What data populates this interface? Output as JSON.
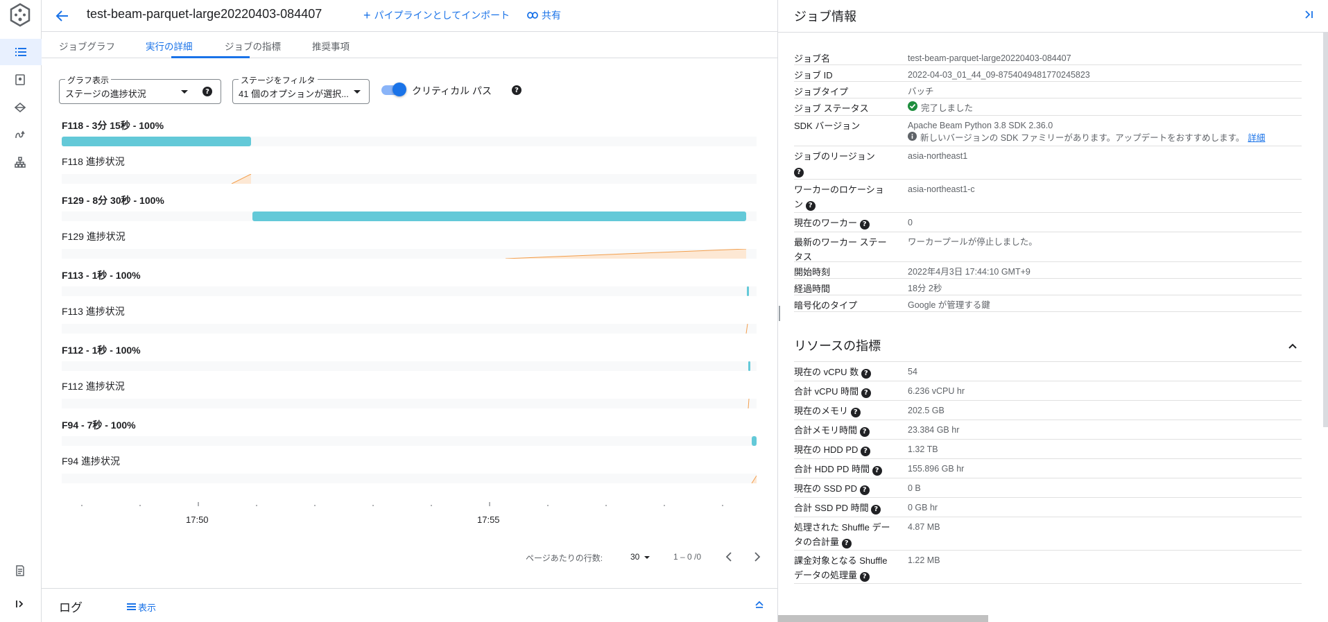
{
  "header": {
    "job_title": "test-beam-parquet-large20220403-084407",
    "import_label": "パイプラインとしてインポート",
    "share_label": "共有"
  },
  "tabs": [
    {
      "label": "ジョブグラフ"
    },
    {
      "label": "実行の詳細"
    },
    {
      "label": "ジョブの指標"
    },
    {
      "label": "推奨事項"
    }
  ],
  "controls": {
    "graph_view": {
      "label": "グラフ表示",
      "value": "ステージの進捗状況"
    },
    "stage_filter": {
      "label": "ステージをフィルタ",
      "value": "41 個のオプションが選択..."
    },
    "critical_path": {
      "label": "クリティカル パス",
      "on": true
    }
  },
  "stages": [
    {
      "title": "F118 - 3分 15秒 - 100%",
      "progress_label": "F118 進捗状況"
    },
    {
      "title": "F129 - 8分 30秒 - 100%",
      "progress_label": "F129 進捗状況"
    },
    {
      "title": "F113 - 1秒 - 100%",
      "progress_label": "F113 進捗状況"
    },
    {
      "title": "F112 - 1秒 - 100%",
      "progress_label": "F112 進捗状況"
    },
    {
      "title": "F94 - 7秒 - 100%",
      "progress_label": "F94 進捗状況"
    }
  ],
  "axis": {
    "ticks": [
      "17:50",
      "17:55"
    ]
  },
  "pager": {
    "rows_label": "ページあたりの行数:",
    "rows_value": "30",
    "range": "1 – 0 /0"
  },
  "log": {
    "title": "ログ",
    "show_label": "表示"
  },
  "job_info": {
    "title": "ジョブ情報",
    "rows": [
      {
        "key": "ジョブ名",
        "value": "test-beam-parquet-large20220403-084407"
      },
      {
        "key": "ジョブ ID",
        "value": "2022-04-03_01_44_09-8754049481770245823"
      },
      {
        "key": "ジョブタイプ",
        "value": "バッチ"
      },
      {
        "key": "ジョブ ステータス",
        "value": "完了しました"
      },
      {
        "key": "SDK バージョン",
        "value": "Apache Beam Python 3.8 SDK 2.36.0",
        "note": "新しいバージョンの SDK ファミリーがあります。アップデートをおすすめします。",
        "note_link": "詳細"
      },
      {
        "key": "ジョブのリージョン",
        "value": "asia-northeast1"
      },
      {
        "key": "ワーカーのロケーション",
        "value": "asia-northeast1-c"
      },
      {
        "key": "現在のワーカー",
        "value": "0"
      },
      {
        "key": "最新のワーカー ステータス",
        "value": "ワーカープールが停止しました。"
      },
      {
        "key": "開始時刻",
        "value": "2022年4月3日 17:44:10 GMT+9"
      },
      {
        "key": "経過時間",
        "value": "18分 2秒"
      },
      {
        "key": "暗号化のタイプ",
        "value": "Google が管理する鍵"
      }
    ]
  },
  "resources": {
    "title": "リソースの指標",
    "rows": [
      {
        "key": "現在の vCPU 数",
        "value": "54"
      },
      {
        "key": "合計 vCPU 時間",
        "value": "6.236 vCPU hr"
      },
      {
        "key": "現在のメモリ",
        "value": "202.5 GB"
      },
      {
        "key": "合計メモリ時間",
        "value": "23.384 GB hr"
      },
      {
        "key": "現在の HDD PD",
        "value": "1.32 TB"
      },
      {
        "key": "合計 HDD PD 時間",
        "value": "155.896 GB hr"
      },
      {
        "key": "現在の SSD PD",
        "value": "0 B"
      },
      {
        "key": "合計 SSD PD 時間",
        "value": "0 GB hr"
      },
      {
        "key": "処理された Shuffle データの合計量",
        "value": "4.87 MB"
      },
      {
        "key": "課金対象となる Shuffle データの処理量",
        "value": "1.22 MB"
      }
    ]
  },
  "colors": {
    "accent": "#1a73e8",
    "stage_bar": "#63c9d8",
    "progress_line": "#f29e4c",
    "success": "#1e8e3e"
  }
}
